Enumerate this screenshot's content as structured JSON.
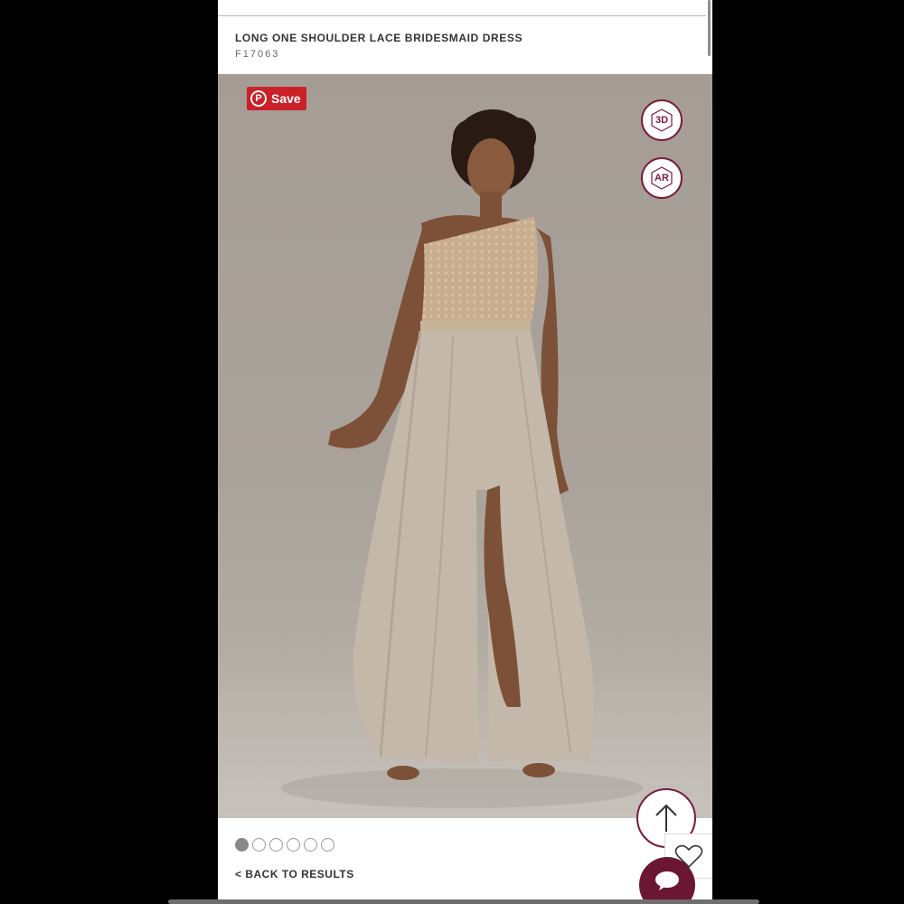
{
  "product": {
    "title": "LONG ONE SHOULDER LACE BRIDESMAID DRESS",
    "sku": "F17063"
  },
  "hero": {
    "save_label": "Save",
    "save_icon": "pinterest-icon",
    "btn_3d_label": "3D",
    "btn_ar_label": "AR"
  },
  "gallery": {
    "total_images": 6,
    "active_index": 0
  },
  "nav": {
    "back_label": "< BACK TO RESULTS"
  },
  "floating": {
    "up_icon": "arrow-up-icon",
    "heart_icon": "heart-icon",
    "chat_icon": "chat-icon"
  },
  "colors": {
    "accent": "#7a1b3a",
    "pinterest": "#cb2027",
    "chat": "#6b1632"
  }
}
